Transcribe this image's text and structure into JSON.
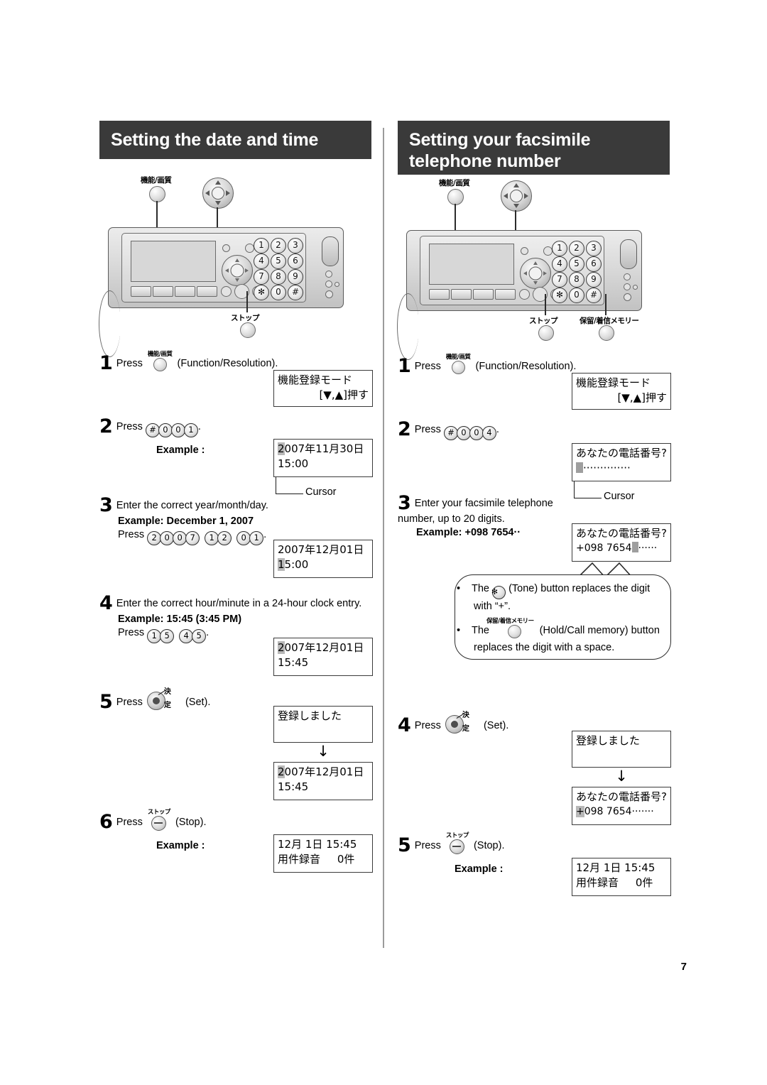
{
  "page": {
    "number": "7"
  },
  "left": {
    "header": "Setting the date and time",
    "device": {
      "function_label": "機能/画質",
      "stop_label": "ストップ",
      "keys": [
        "1",
        "2",
        "3",
        "4",
        "5",
        "6",
        "7",
        "8",
        "9",
        "✻",
        "0",
        "#"
      ]
    },
    "steps": [
      {
        "num": "1",
        "press_word": "Press",
        "button_label": "機能/画質",
        "paren": "(Function/Resolution).",
        "display": {
          "line1": "機能登録モード",
          "line2": "[▼,▲]押す"
        }
      },
      {
        "num": "2",
        "press_word": "Press",
        "keys": [
          "#",
          "0",
          "0",
          "1"
        ],
        "trailing": ".",
        "example_label": "Example :",
        "display": {
          "line1": "2007年11月30日",
          "line2": "15:00",
          "cursor_char": "2"
        },
        "cursor_label": "Cursor"
      },
      {
        "num": "3",
        "text": "Enter the correct year/month/day.",
        "example_bold": "Example: December 1, 2007",
        "press_word": "Press",
        "key_groups": [
          [
            "2",
            "0",
            "0",
            "7"
          ],
          [
            "1",
            "2"
          ],
          [
            "0",
            "1"
          ]
        ],
        "trailing": ".",
        "display": {
          "line1": "2007年12月01日",
          "line2": "15:00",
          "cursor_char": "1"
        }
      },
      {
        "num": "4",
        "text": "Enter the correct hour/minute in a 24-hour clock entry.",
        "example_bold": "Example: 15:45 (3:45 PM)",
        "press_word": "Press",
        "key_groups": [
          [
            "1",
            "5"
          ],
          [
            "4",
            "5"
          ]
        ],
        "trailing": ".",
        "display": {
          "line1": "2007年12月01日",
          "line2": "15:45",
          "cursor_char": "2"
        }
      },
      {
        "num": "5",
        "press_word": "Press",
        "set_label": "決定",
        "paren": "(Set).",
        "display": {
          "line1": "登録しました",
          "line2": ""
        },
        "arrow": "↓",
        "display2": {
          "line1": "2007年12月01日",
          "line2": "15:45",
          "cursor_char": "2"
        }
      },
      {
        "num": "6",
        "press_word": "Press",
        "stop_label": "ストップ",
        "paren": "(Stop).",
        "example_label": "Example :",
        "display": {
          "line1": "12月 1日 15:45",
          "line2": "用件録音     0件"
        }
      }
    ]
  },
  "right": {
    "header": "Setting your facsimile telephone number",
    "device": {
      "function_label": "機能/画質",
      "stop_label": "ストップ",
      "hold_label": "保留/着信メモリー",
      "keys": [
        "1",
        "2",
        "3",
        "4",
        "5",
        "6",
        "7",
        "8",
        "9",
        "✻",
        "0",
        "#"
      ]
    },
    "steps": [
      {
        "num": "1",
        "press_word": "Press",
        "button_label": "機能/画質",
        "paren": "(Function/Resolution).",
        "display": {
          "line1": "機能登録モード",
          "line2": "[▼,▲]押す"
        }
      },
      {
        "num": "2",
        "press_word": "Press",
        "keys": [
          "#",
          "0",
          "0",
          "4"
        ],
        "trailing": ".",
        "display": {
          "line1": "あなたの電話番号?",
          "line2": "··············"
        },
        "cursor_label": "Cursor"
      },
      {
        "num": "3",
        "text": "Enter your facsimile telephone number, up to 20 digits.",
        "example_bold": "Example: +098 7654··",
        "display": {
          "line1": "あなたの電話番号?",
          "line2": "+098 7654",
          "dots": "······"
        },
        "bubble": {
          "item1_pre": "The",
          "item1_icon": "✻",
          "item1_post": "(Tone) button replaces the digit with “+”.",
          "item2_pre": "The",
          "item2_btn_label": "保留/着信メモリー",
          "item2_post": "(Hold/Call memory) button replaces the digit with a space."
        }
      },
      {
        "num": "4",
        "press_word": "Press",
        "set_label": "決定",
        "paren": "(Set).",
        "display": {
          "line1": "登録しました",
          "line2": ""
        },
        "arrow": "↓",
        "display2": {
          "line1": "あなたの電話番号?",
          "line2": "+098 7654·······",
          "cursor_char": "+"
        }
      },
      {
        "num": "5",
        "press_word": "Press",
        "stop_label": "ストップ",
        "paren": "(Stop).",
        "example_label": "Example :",
        "display": {
          "line1": "12月 1日 15:45",
          "line2": "用件録音     0件"
        }
      }
    ]
  }
}
